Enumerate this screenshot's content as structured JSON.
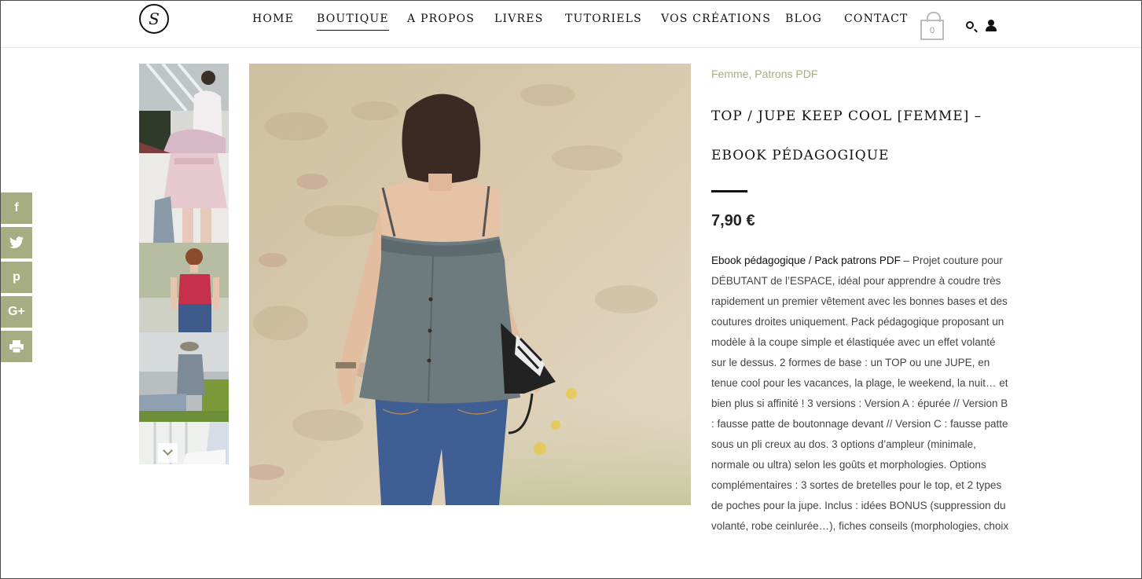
{
  "nav": {
    "logo_letter": "S",
    "items": [
      "HOME",
      "BOUTIQUE",
      "A PROPOS",
      "LIVRES",
      "TUTORIELS",
      "VOS CRÉATIONS",
      "BLOG",
      "CONTACT"
    ],
    "active": "BOUTIQUE",
    "cart_count": "0",
    "icons": [
      "cart-icon",
      "search-icon",
      "user-icon"
    ]
  },
  "social": [
    "f",
    "t",
    "p",
    "G+",
    "print"
  ],
  "product": {
    "category_1": "Femme",
    "category_sep": ",",
    "category_2": "Patrons PDF",
    "title": "TOP / JUPE KEEP COOL [FEMME] – EBOOK PÉDAGOGIQUE",
    "price": "7,90 €",
    "desc_lead": "Ebook pédagogique / Pack patrons PDF",
    "desc_rest": " – Projet couture pour DÉBUTANT de l’ESPACE, idéal pour apprendre à coudre très rapidement un premier vêtement avec les bonnes bases et des coutures droites uniquement. Pack pédagogique proposant un modèle à la coupe simple et élastiquée avec un effet volanté sur le dessus. 2 formes de base : un TOP ou une JUPE, en tenue cool pour les vacances, la plage, le weekend, la nuit… et bien plus si affinité ! 3 versions : Version A : épurée // Version B : fausse patte de boutonnage devant // Version C : fausse patte sous un pli creux au dos. 3 options d’ampleur (minimale, normale ou ultra) selon les goûts et morphologies. Options complémentaires : 3 sortes de bretelles pour le top, et 2 types de poches pour la jupe. Inclus : idées BONUS (suppression du volanté, robe ceinlurée…), fiches conseils (morphologies, choix"
  },
  "colors": {
    "accent": "#a7ad82",
    "text": "#111111"
  }
}
